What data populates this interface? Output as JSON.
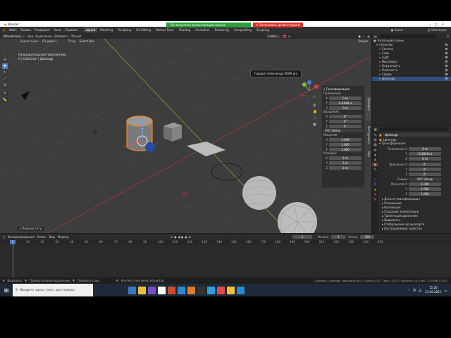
{
  "notification": {
    "message": "Вы запустили демонстрацию экрана",
    "stop_label": "Остановить демонстрацию",
    "colors": {
      "green": "#2e9e3a",
      "red": "#d8322d"
    }
  },
  "window": {
    "title": "Blender"
  },
  "menu": {
    "items": [
      "Файл",
      "Правка",
      "Рендеринг",
      "Окно",
      "Справка"
    ],
    "workspaces": [
      "Layout",
      "Modeling",
      "Sculpting",
      "UV Editing",
      "Texture Paint",
      "Shading",
      "Animation",
      "Rendering",
      "Compositing",
      "Scripting"
    ],
    "active_workspace": "Layout",
    "scene_label": "Scene",
    "view_layer_label": "View Layer"
  },
  "viewport_header": {
    "mode": "Объектный ...",
    "view": "Вид",
    "select": "Выделение",
    "add": "Добавить",
    "object": "Объект",
    "orientation": "Ориентация:",
    "orientation_value": "По умолч...",
    "drag": "Drag:",
    "drag_value": "Select Box",
    "global": "Глоба...",
    "options": "Опции"
  },
  "viewport_info": {
    "line1": "Пользовательская перспектива",
    "line2": "(1) Collection | Цилиндр"
  },
  "tooltip": "Говорит Александр VRAR pro",
  "n_panel": {
    "section": "Трансформация",
    "location_label": "Положение:",
    "location": [
      [
        "X",
        "0 m"
      ],
      [
        "Y",
        "-6.4848 m"
      ],
      [
        "Z",
        "0 m"
      ]
    ],
    "rotation_label": "Вращение:",
    "rotation": [
      [
        "X",
        "0°"
      ],
      [
        "Y",
        "0°"
      ],
      [
        "Z",
        "0°"
      ]
    ],
    "rotation_mode": "XYZ Эйлер",
    "scale_label": "Масштаб:",
    "scale": [
      [
        "X",
        "1.000"
      ],
      [
        "Y",
        "1.000"
      ],
      [
        "Z",
        "1.000"
      ]
    ],
    "dimensions_label": "Размеры:",
    "dimensions": [
      [
        "X",
        "2 m"
      ],
      [
        "Y",
        "2 m"
      ],
      [
        "Z",
        "2 m"
      ]
    ],
    "tabs": [
      "Элемент",
      "Инструмент",
      "Вид"
    ]
  },
  "outliner": {
    "scene_collection": "Коллекция сцены",
    "items": [
      {
        "name": "Collection",
        "color": "#d0d0d0",
        "selected": false
      },
      {
        "name": "Camera",
        "color": "#8fbf6f",
        "selected": false
      },
      {
        "name": "Cube",
        "color": "#e0a050",
        "selected": false
      },
      {
        "name": "Light",
        "color": "#8fbf6f",
        "selected": false
      },
      {
        "name": "Икосфера",
        "color": "#e0a050",
        "selected": false
      },
      {
        "name": "Окружность",
        "color": "#e0a050",
        "selected": false
      },
      {
        "name": "Плоскость",
        "color": "#e0a050",
        "selected": false
      },
      {
        "name": "Сфера",
        "color": "#e0a050",
        "selected": false
      },
      {
        "name": "Цилиндр",
        "color": "#e0a050",
        "selected": true
      }
    ]
  },
  "properties": {
    "object_name": "Цилиндр",
    "subheader": "Цилиндр",
    "transform_section": "Трансформация",
    "location_label": "Положение X",
    "location": [
      [
        "",
        "0 m"
      ],
      [
        "Y",
        "-6.4848 m"
      ],
      [
        "Z",
        "0 m"
      ]
    ],
    "rotation_label": "Вращение X",
    "rotation": [
      [
        "",
        "0°"
      ],
      [
        "Y",
        "0°"
      ],
      [
        "Z",
        "0°"
      ]
    ],
    "mode_label": "Режим",
    "mode_value": "XYZ Эйлер",
    "scale_label": "Масштаб X",
    "scale": [
      [
        "",
        "1.000"
      ],
      [
        "Y",
        "1.000"
      ],
      [
        "Z",
        "1.000"
      ]
    ],
    "sections": [
      "Дельта-трансформация",
      "Отношения",
      "Коллекции",
      "Создание экземпляров",
      "Траектория движения",
      "Видимость",
      "Отображение во вьюпорте",
      "Настраиваемые свойства"
    ]
  },
  "footer_popup": "Переместить",
  "timeline": {
    "playback": "Воспроизведение",
    "keying": "Кеинг",
    "view": "Вид",
    "marker": "Маркер",
    "current_frame": "1",
    "start_label": "Начало",
    "start_value": "1",
    "end_label": "Конец",
    "end_value": "250",
    "ticks": [
      "0",
      "10",
      "20",
      "30",
      "40",
      "50",
      "60",
      "70",
      "80",
      "90",
      "100",
      "110",
      "120",
      "130",
      "140",
      "150",
      "160",
      "170",
      "180",
      "190",
      "200",
      "210",
      "220",
      "230",
      "240",
      "250"
    ]
  },
  "status_bar": {
    "left1": "Выделить",
    "left2": "Прямоугольное выделение",
    "left3": "Повернуть вид",
    "middle": "Контекстное меню объектов",
    "right": "Collection | Цилиндр | Вершины:8/12 | Грани:1/102 | Треуг.:1/170 | Объекты:1/8 | Пам.: 27.5 MiB | 2.93.1"
  },
  "taskbar": {
    "search_placeholder": "Введите здесь текст для поиска",
    "time": "15:26",
    "date": "21.06.2021",
    "icon_colors": [
      "#3a78c2",
      "#e8c040",
      "#7a4fc0",
      "#ffffff",
      "#d04a2a",
      "#2a8ad0",
      "#e07a30",
      "#333333",
      "#2aa0e0",
      "#e04a4a",
      "#f0c040",
      "#2a8ad0"
    ]
  }
}
